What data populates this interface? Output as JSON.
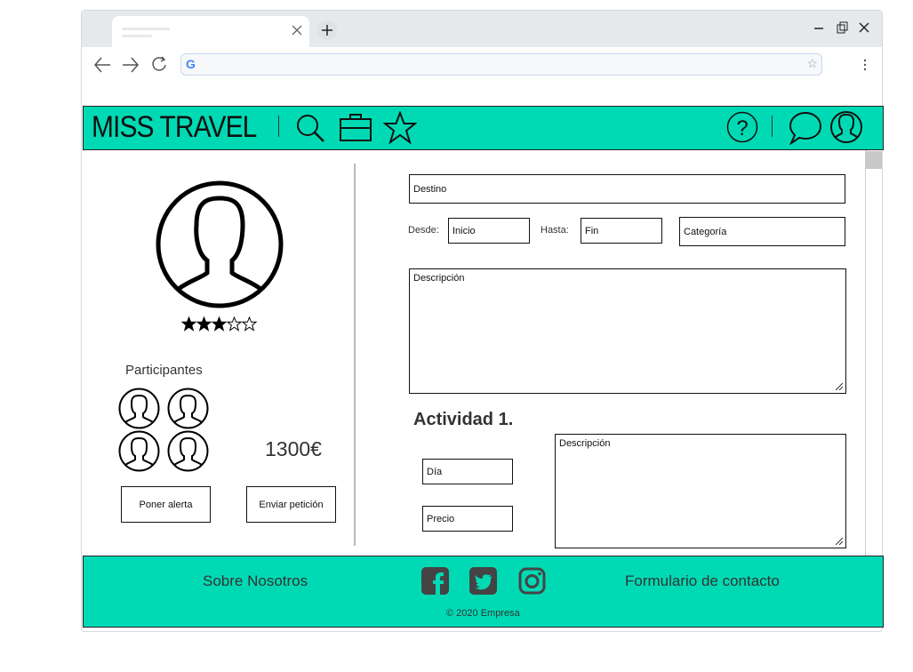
{
  "header": {
    "logo": "MISS TRAVEL"
  },
  "profile": {
    "rating": 3,
    "max_rating": 5,
    "participants_label": "Participantes",
    "price": "1300€",
    "alert_button": "Poner alerta",
    "request_button": "Enviar petición"
  },
  "form": {
    "destino_placeholder": "Destino",
    "desde_label": "Desde:",
    "inicio_placeholder": "Inicio",
    "hasta_label": "Hasta:",
    "fin_placeholder": "Fin",
    "categoria_placeholder": "Categoría",
    "descripcion_placeholder": "Descripción"
  },
  "activity": {
    "title": "Actividad 1.",
    "dia_placeholder": "Día",
    "precio_placeholder": "Precio",
    "descripcion_placeholder": "Descripción"
  },
  "footer": {
    "about": "Sobre Nosotros",
    "contact": "Formulario de contacto",
    "copyright": "© 2020 Empresa"
  },
  "colors": {
    "brand": "#00dab4"
  }
}
